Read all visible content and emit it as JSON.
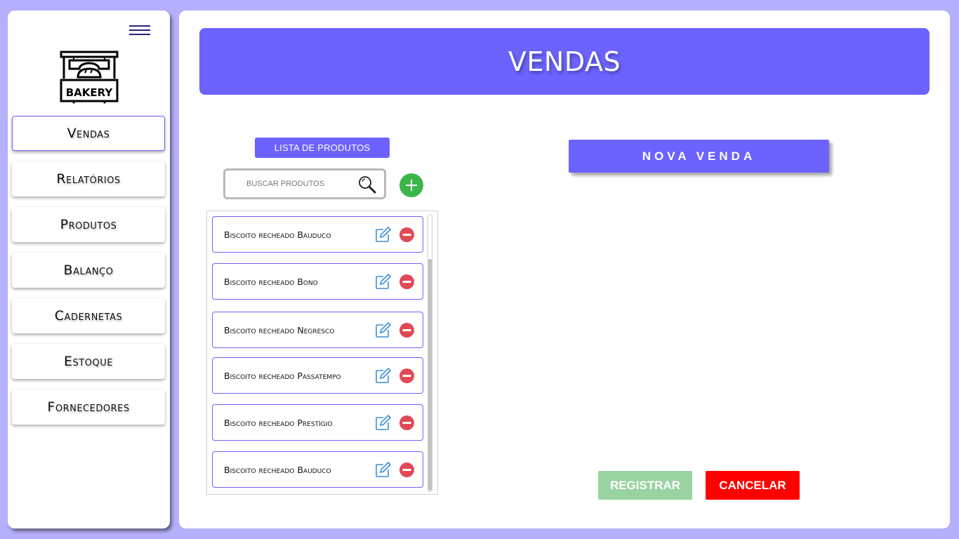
{
  "colors": {
    "background": "#b5b0fb",
    "accent": "#6c63ff",
    "add": "#3bb54a",
    "remove": "#e04a57",
    "edit": "#3b8fd6",
    "register": "#9ad3a2",
    "cancel": "#ff0000"
  },
  "sidebar": {
    "menu_icon": "hamburger-icon",
    "logo_text": "BAKERY",
    "items": [
      {
        "label": "Vendas",
        "active": true
      },
      {
        "label": "Relatórios"
      },
      {
        "label": "Produtos"
      },
      {
        "label": "Balanço"
      },
      {
        "label": "Cadernetas"
      },
      {
        "label": "Estoque"
      },
      {
        "label": "Fornecedores"
      }
    ]
  },
  "header": {
    "title": "VENDAS"
  },
  "products": {
    "list_label": "LISTA DE PRODUTOS",
    "search_placeholder": "BUSCAR PRODUTOS",
    "items": [
      "Biscoito recheado Bauduco",
      "Biscoito recheado Bono",
      "Biscoito recheado Negresco",
      "Biscoito recheado Passatempo",
      "Biscoito recheado Prestígio",
      "Biscoito recheado Bauduco"
    ]
  },
  "sale": {
    "new_sale_label": "NOVA VENDA",
    "register_label": "REGISTRAR",
    "cancel_label": "CANCELAR"
  }
}
